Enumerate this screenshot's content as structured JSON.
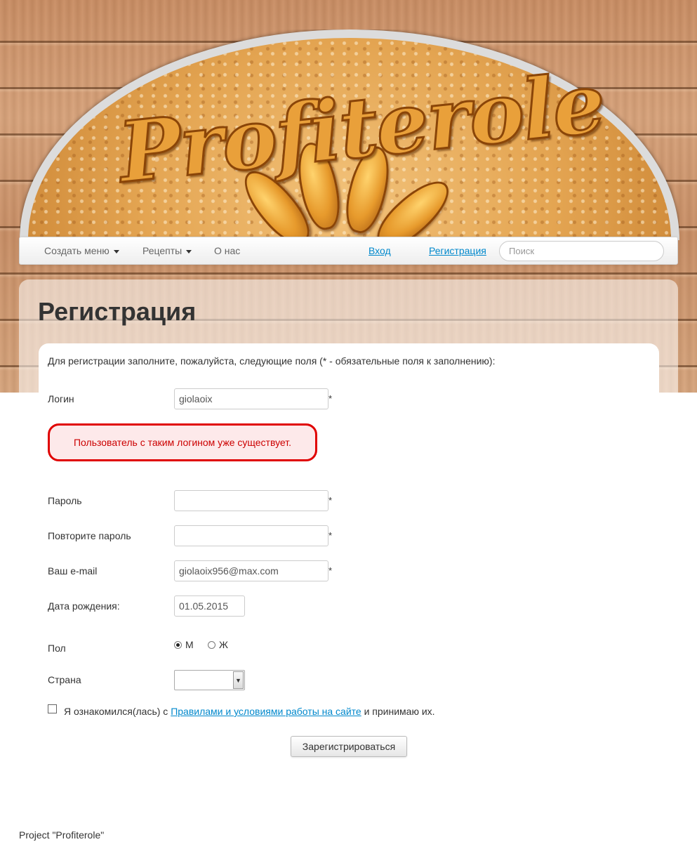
{
  "logo": {
    "text": "Profiterole"
  },
  "nav": {
    "create_menu": "Создать меню",
    "recipes": "Рецепты",
    "about": "О нас",
    "login": "Вход",
    "register": "Регистрация",
    "search_placeholder": "Поиск"
  },
  "page": {
    "title": "Регистрация",
    "intro": "Для регистрации заполните, пожалуйста, следующие поля (* - обязательные поля к заполнению):"
  },
  "form": {
    "required_mark": "*",
    "login_label": "Логин",
    "login_value": "giolaoix",
    "error_message": "Пользователь с таким логином уже существует.",
    "password_label": "Пароль",
    "password_value": "",
    "password_repeat_label": "Повторите пароль",
    "password_repeat_value": "",
    "email_label": "Ваш e-mail",
    "email_value": "giolaoix956@max.com",
    "birthdate_label": "Дата рождения:",
    "birthdate_value": "01.05.2015",
    "gender_label": "Пол",
    "gender_options": [
      "М",
      "Ж"
    ],
    "gender_selected": "М",
    "country_label": "Страна",
    "country_value": "",
    "agree_prefix": "Я ознакомился(лась) с ",
    "agree_link": "Правилами и условиями работы на сайте",
    "agree_suffix": " и принимаю их.",
    "submit_label": "Зарегистрироваться"
  },
  "footer": {
    "text": "Project \"Profiterole\""
  },
  "colors": {
    "link": "#0088cc",
    "error": "#cc0000",
    "error_border": "#e00000"
  }
}
